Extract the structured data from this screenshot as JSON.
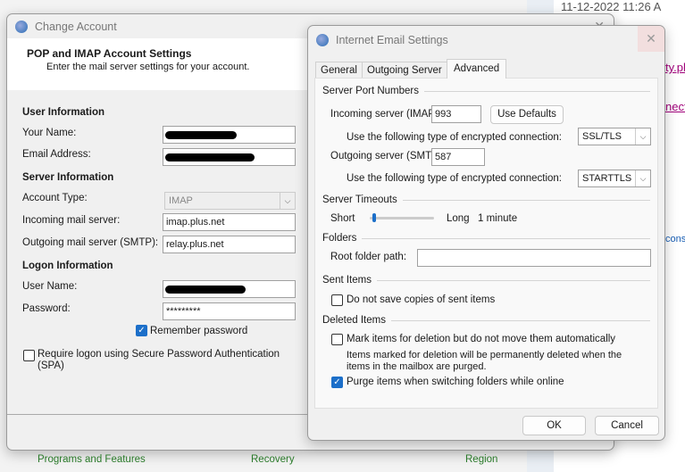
{
  "background": {
    "timestamp": "11-12-2022 11:26 A",
    "link1": "ty.pl",
    "link2": "nect",
    "link3": "cons",
    "bottom_items": [
      "Programs and Features",
      "Recovery",
      "Region"
    ]
  },
  "change_account": {
    "title": "Change Account",
    "heading": "POP and IMAP Account Settings",
    "subheading": "Enter the mail server settings for your account.",
    "user_info": "User Information",
    "your_name_label": "Your Name:",
    "email_label": "Email Address:",
    "server_info": "Server Information",
    "account_type_label": "Account Type:",
    "account_type": "IMAP",
    "incoming_label": "Incoming mail server:",
    "incoming": "imap.plus.net",
    "outgoing_label": "Outgoing mail server (SMTP):",
    "outgoing": "relay.plus.net",
    "logon_info": "Logon Information",
    "username_label": "User Name:",
    "password_label": "Password:",
    "password": "*********",
    "remember": "Remember password",
    "spa": "Require logon using Secure Password Authentication (SPA)"
  },
  "internet_settings": {
    "title": "Internet Email Settings",
    "tabs": [
      "General",
      "Outgoing Server",
      "Advanced"
    ],
    "ports": "Server Port Numbers",
    "imap_label": "Incoming server (IMAP):",
    "imap_port": "993",
    "use_defaults": "Use Defaults",
    "enc_label": "Use the following type of encrypted connection:",
    "imap_enc": "SSL/TLS",
    "smtp_label": "Outgoing server (SMTP):",
    "smtp_port": "587",
    "smtp_enc": "STARTTLS",
    "timeouts": "Server Timeouts",
    "short": "Short",
    "long": "Long",
    "timeout_value": "1 minute",
    "timeout_fraction": 0.05,
    "folders": "Folders",
    "root_label": "Root folder path:",
    "root_value": "",
    "sent": "Sent Items",
    "no_save": "Do not save copies of sent items",
    "deleted": "Deleted Items",
    "mark": "Mark items for deletion but do not move them automatically",
    "mark_note": "Items marked for deletion will be permanently deleted when the items in the mailbox are purged.",
    "purge": "Purge items when switching folders while online",
    "ok": "OK",
    "cancel": "Cancel"
  }
}
